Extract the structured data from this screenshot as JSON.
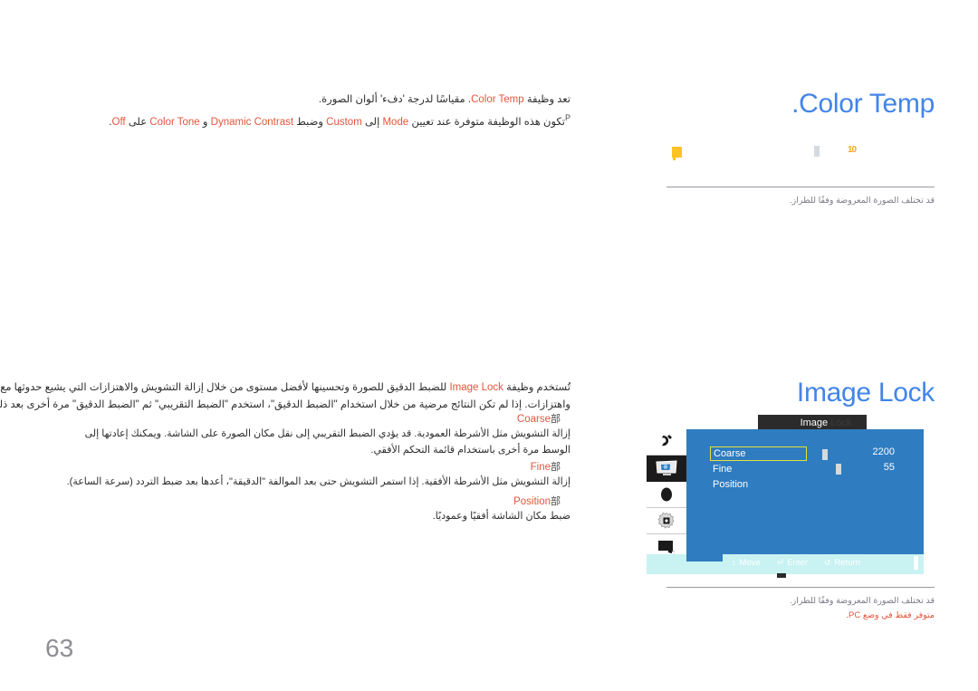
{
  "document": {
    "page_number": "63"
  },
  "sections": [
    {
      "title": ".Color Temp",
      "lead_lines": [
        {
          "pre": "تعد وظيفة ",
          "hl": "Color Temp",
          "post": ". مقياسًا لدرجة 'دفء' ألوان الصورة."
        },
        {
          "pre": "تكون هذه الوظيفة متوفرة عند تعيين ",
          "post": "."
        }
      ]
    },
    {
      "title": "Image Lock"
    }
  ],
  "color_temp": {
    "line1_pre": "تعد وظيفة ",
    "line1_hl": "Color Temp",
    "line1_post": ". مقياسًا لدرجة 'دفء' ألوان الصورة.",
    "line2_sup": "P",
    "line2_a": "تكون هذه الوظيفة متوفرة عند تعيين ",
    "line2_mode": "Mode",
    "line2_b": " إلى ",
    "line2_custom": "Custom",
    "line2_c": " وضبط ",
    "line2_dc": "Dynamic Contrast",
    "line2_d": " و ",
    "line2_ct": "Color Tone",
    "line2_e": " على ",
    "line2_off": "Off",
    "line2_f": "."
  },
  "image_lock": {
    "title": "Image Lock",
    "body_line1_a": "تُستخدم وظيفة ",
    "body_line1_hl": "Image Lock",
    "body_line1_b": " للضبط الدقيق للصورة وتحسينها لأفضل مستوى من خلال إزالة التشويش والاهتزازات التي يشيع حدوثها مع صور ثابتة غير مصححة وتشوه هذه",
    "body_line2": "واهتزازات. إذا لم تكن النتائج مرضية من خلال استخدام \"الضبط الدقيق\"، استخدم \"الضبط التقريبي\" ثم \"الضبط الدقيق\" مرة أخرى بعد ذلك.",
    "items": [
      {
        "bullet": "部",
        "label": "Coarse",
        "description": "إزالة التشويش مثل الأشرطة العمودية. قد يؤدي الضبط التقريبي إلى نقل مكان الصورة على الشاشة. ويمكنك إعادتها إلى الوسط مرة أخرى باستخدام قائمة التحكم الأفقي."
      },
      {
        "bullet": "部",
        "label": "Fine",
        "description": "إزالة التشويش مثل الأشرطة الأفقية. إذا استمر التشويش حتى بعد الموالفة \"الدقيقة\"، أعدها بعد ضبط التردد (سرعة الساعة)."
      },
      {
        "bullet": "部",
        "label": "Position",
        "description": "ضبط مكان الشاشة أفقيًا وعموديًا."
      }
    ]
  },
  "notes": {
    "top": [
      "قد تختلف الصورة المعروضة وفقًا للطراز."
    ],
    "bottom": [
      "قد تختلف الصورة المعروضة وفقًا للطراز.",
      "متوفر فقط في وضع PC."
    ]
  },
  "osd_fragment": {
    "flag_icon": "flag-icon",
    "slider_icon": "slider-thumb",
    "value": "10"
  },
  "osd": {
    "titlebar": "Image",
    "titlebar_dim": " Lock",
    "sidebar_icons": [
      "input-source-icon",
      "picture-icon",
      "sound-icon",
      "settings-gear-icon",
      "device-icon"
    ],
    "menu_items": [
      {
        "label": "Coarse",
        "value": "2200",
        "selected": true
      },
      {
        "label": "Fine",
        "value": "55",
        "selected": false
      },
      {
        "label": "Position",
        "value": "",
        "selected": false
      }
    ],
    "hints": [
      {
        "glyph": "↕",
        "label": "Move"
      },
      {
        "glyph": "⏎",
        "label": "Enter"
      },
      {
        "glyph": "↺",
        "label": "Return"
      }
    ]
  },
  "colors": {
    "heading_blue": "#4285e8",
    "accent_orange": "#e2563c",
    "osd_panel_blue": "#2f7cc0",
    "osd_bottombar": "#c9f2f2",
    "osd_highlight_border": "#e2e23a",
    "note_gray": "#7c7c8a",
    "flag_yellow": "#ffc421"
  }
}
